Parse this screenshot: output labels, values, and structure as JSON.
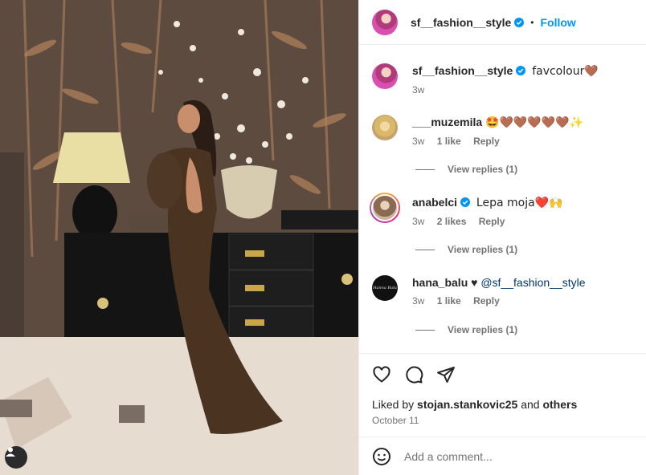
{
  "post": {
    "author": "sf__fashion__style",
    "follow_label": "Follow",
    "separator": "•",
    "caption_text": "favcolour🤎",
    "caption_time": "3w"
  },
  "comments": [
    {
      "username": "___muzemila",
      "text": "🤩🤎🤎🤎🤎🤎✨",
      "time": "3w",
      "likes": "1 like",
      "reply": "Reply",
      "view_replies": "View replies (1)"
    },
    {
      "username": "anabelci",
      "text": "Lepa moja❤️🙌",
      "time": "3w",
      "likes": "2 likes",
      "reply": "Reply",
      "view_replies": "View replies (1)"
    },
    {
      "username": "hana_balu",
      "heart": "♥",
      "mention": "@sf__fashion__style",
      "time": "3w",
      "likes": "1 like",
      "reply": "Reply",
      "view_replies": "View replies (1)",
      "avatar_text": "Hanna Balu"
    }
  ],
  "footer": {
    "liked_prefix": "Liked by",
    "liked_user": "stojan.stankovic25",
    "liked_and": "and",
    "liked_others": "others",
    "date": "October 11",
    "comment_placeholder": "Add a comment..."
  },
  "icons": [
    "heart-icon",
    "comment-icon",
    "share-icon",
    "emoji-icon",
    "tag-user-icon",
    "verified-icon"
  ],
  "colors": {
    "accent": "#0095f6",
    "verified": "#0095f6",
    "mention": "#00376b",
    "muted": "#737373"
  }
}
